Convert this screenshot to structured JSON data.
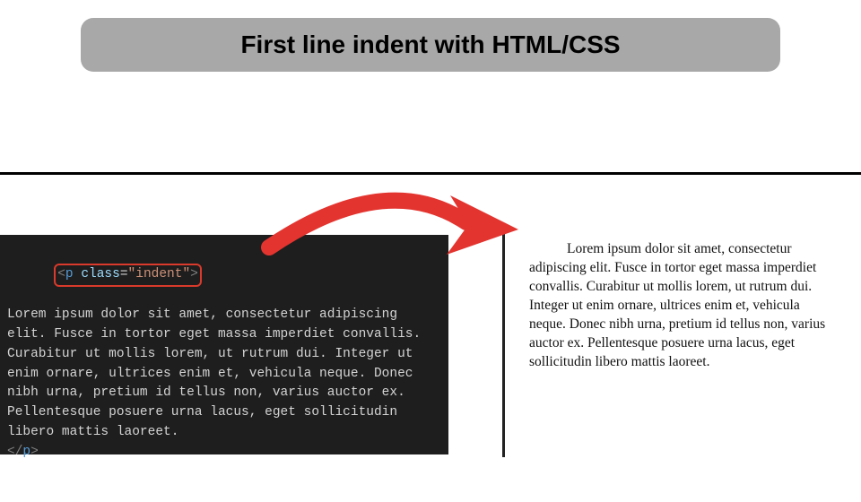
{
  "title": "First line indent with HTML/CSS",
  "code": {
    "open_tag": {
      "lt": "<",
      "name": "p",
      "attr_name": "class",
      "eq": "=",
      "attr_value": "\"indent\"",
      "gt": ">"
    },
    "body": "Lorem ipsum dolor sit amet, consectetur adipiscing elit. Fusce in tortor eget massa imperdiet convallis. Curabitur ut mollis lorem, ut rutrum dui. Integer ut enim ornare, ultrices enim et, vehicula neque. Donec nibh urna, pretium id tellus non, varius auctor ex. Pellentesque posuere urna lacus, eget sollicitudin libero mattis laoreet.",
    "close_tag": {
      "lt": "</",
      "name": "p",
      "gt": ">"
    }
  },
  "rendered_text": "Lorem ipsum dolor sit amet, consectetur adipiscing elit. Fusce in tortor eget massa imperdiet convallis. Curabitur ut mollis lorem, ut rutrum dui. Integer ut enim ornare, ultrices enim et, vehicula neque. Donec nibh urna, pretium id tellus non, varius auctor ex. Pellentesque posuere urna lacus, eget sollicitudin libero mattis laoreet.",
  "colors": {
    "title_bg": "#a8a8a8",
    "code_bg": "#1e1e1e",
    "arrow": "#e3342f",
    "highlight_border": "#d93a2b"
  }
}
